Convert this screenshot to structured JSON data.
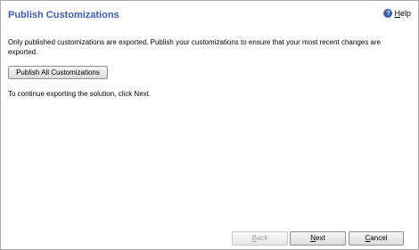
{
  "dialog": {
    "title": "Publish Customizations",
    "help": {
      "accelerator": "H",
      "rest": "elp",
      "icon": "help-question-icon"
    },
    "info_text": "Only published customizations are exported. Publish your customizations to ensure that your most recent changes are exported.",
    "publish_button_label": "Publish All Customizations",
    "continue_text": "To continue exporting the solution, click Next."
  },
  "footer": {
    "back": {
      "accelerator": "B",
      "rest": "ack",
      "enabled": false
    },
    "next": {
      "accelerator": "N",
      "rest": "ext",
      "enabled": true
    },
    "cancel": {
      "accelerator": "C",
      "rest": "ancel",
      "enabled": true
    }
  },
  "colors": {
    "title": "#3b5bb5",
    "help_icon": "#3a5fb0",
    "border": "#a9a9a9",
    "disabled_text": "#a0a0a0"
  }
}
